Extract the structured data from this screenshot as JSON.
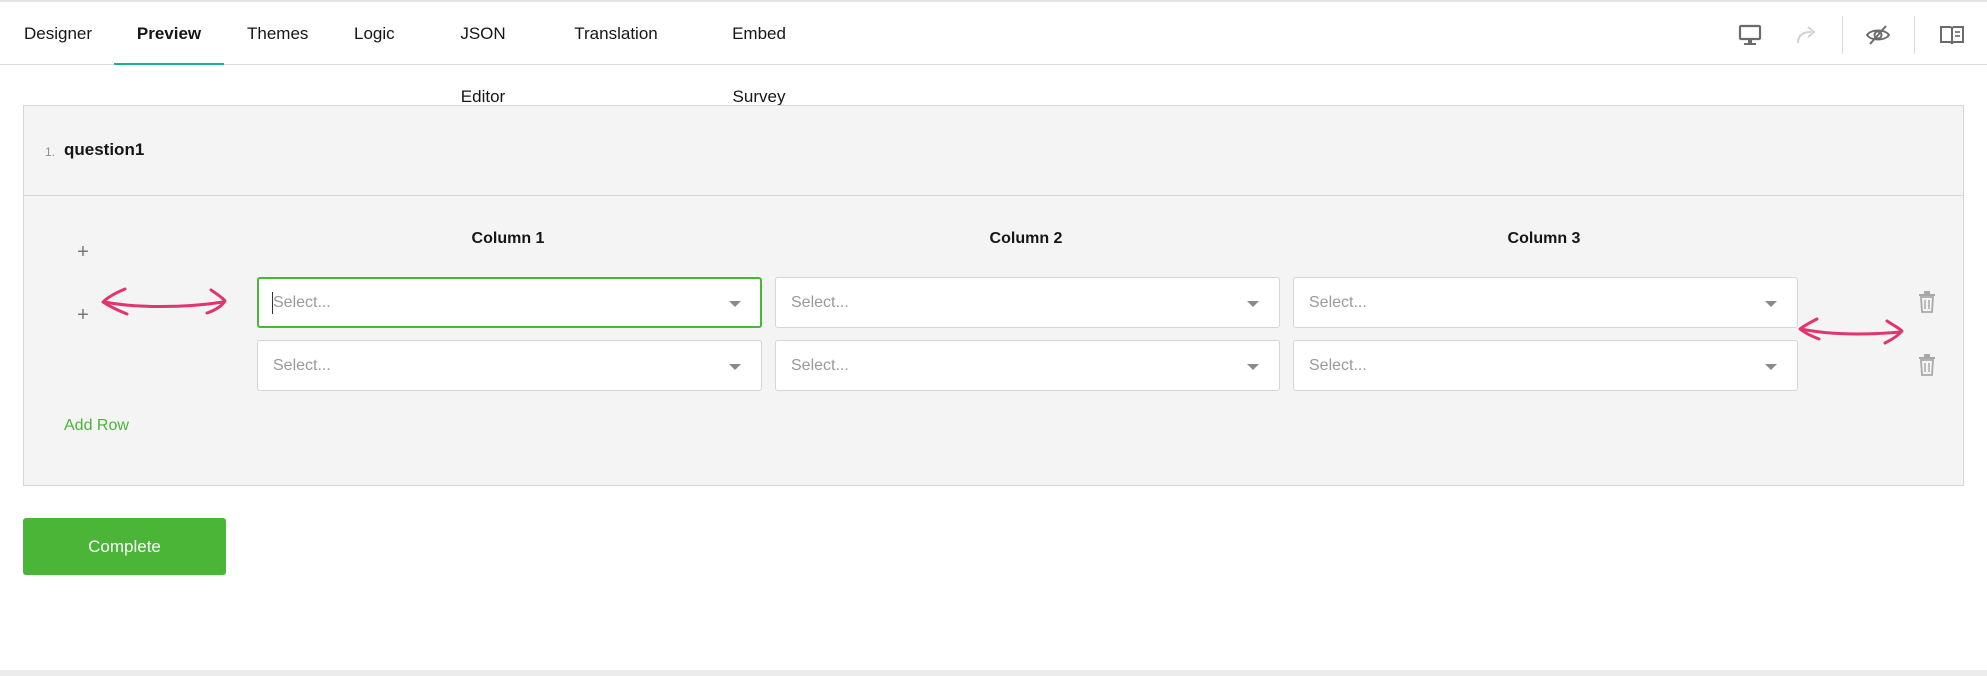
{
  "tabs": [
    {
      "label": "Designer",
      "active": false
    },
    {
      "label": "Preview",
      "active": true
    },
    {
      "label": "Themes",
      "active": false
    },
    {
      "label": "Logic",
      "active": false
    },
    {
      "label": "JSON Editor",
      "active": false
    },
    {
      "label": "Translation",
      "active": false
    },
    {
      "label": "Embed Survey",
      "active": false
    }
  ],
  "toolbar": {
    "icons": [
      "desktop-icon",
      "redo-icon",
      "eye-off-icon",
      "book-icon"
    ]
  },
  "question": {
    "number": "1.",
    "title": "question1",
    "columns": [
      "Column 1",
      "Column 2",
      "Column 3"
    ],
    "rows": [
      {
        "cells": [
          {
            "placeholder": "Select...",
            "focused": true
          },
          {
            "placeholder": "Select..."
          },
          {
            "placeholder": "Select..."
          }
        ]
      },
      {
        "cells": [
          {
            "placeholder": "Select..."
          },
          {
            "placeholder": "Select..."
          },
          {
            "placeholder": "Select..."
          }
        ]
      }
    ],
    "add_row_label": "Add Row"
  },
  "complete_label": "Complete",
  "colors": {
    "accent_tab": "#19b394",
    "primary": "#4ab536",
    "annotation": "#e0356e"
  }
}
